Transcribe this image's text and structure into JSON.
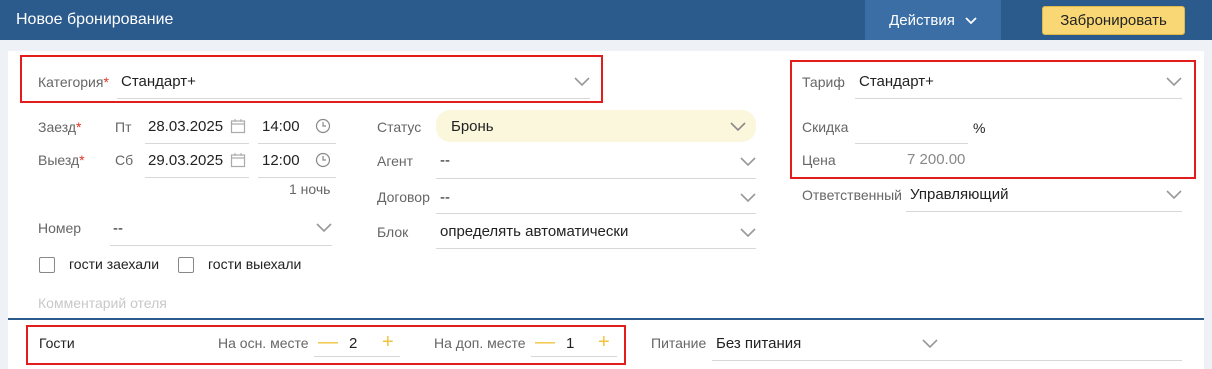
{
  "header": {
    "title": "Новое бронирование",
    "actions_label": "Действия",
    "book_label": "Забронировать"
  },
  "category": {
    "label": "Категория",
    "required_mark": "*",
    "value": "Стандарт+"
  },
  "checkin": {
    "label": "Заезд",
    "required_mark": "*",
    "weekday": "Пт",
    "date": "28.03.2025",
    "time": "14:00"
  },
  "checkout": {
    "label": "Выезд",
    "required_mark": "*",
    "weekday": "Сб",
    "date": "29.03.2025",
    "time": "12:00"
  },
  "nights": "1 ночь",
  "room": {
    "label": "Номер",
    "value": "--"
  },
  "checkboxes": {
    "checked_in_label": "гости заехали",
    "checked_out_label": "гости выехали"
  },
  "comment_placeholder": "Комментарий отеля",
  "status": {
    "label": "Статус",
    "value": "Бронь"
  },
  "agent": {
    "label": "Агент",
    "value": "--"
  },
  "contract": {
    "label": "Договор",
    "value": "--"
  },
  "block": {
    "label": "Блок",
    "value": "определять автоматически"
  },
  "tariff": {
    "label": "Тариф",
    "value": "Стандарт+"
  },
  "discount": {
    "label": "Скидка",
    "value": "",
    "unit": "%"
  },
  "price": {
    "label": "Цена",
    "value": "7 200.00"
  },
  "responsible": {
    "label": "Ответственный",
    "value": "Управляющий"
  },
  "guests": {
    "label": "Гости",
    "main_label": "На осн. месте",
    "main_count": "2",
    "extra_label": "На доп. месте",
    "extra_count": "1",
    "minus": "—",
    "plus": "+"
  },
  "meal": {
    "label": "Питание",
    "value": "Без питания"
  },
  "colors": {
    "header": "#2b5a8c",
    "actions": "#3a6ea5",
    "accent": "#f8d774",
    "highlight": "#e31c1c",
    "status_bg": "#fbf7dc"
  },
  "icons": [
    "chevron-down-icon",
    "calendar-icon",
    "clock-icon",
    "plus-icon",
    "minus-icon"
  ]
}
